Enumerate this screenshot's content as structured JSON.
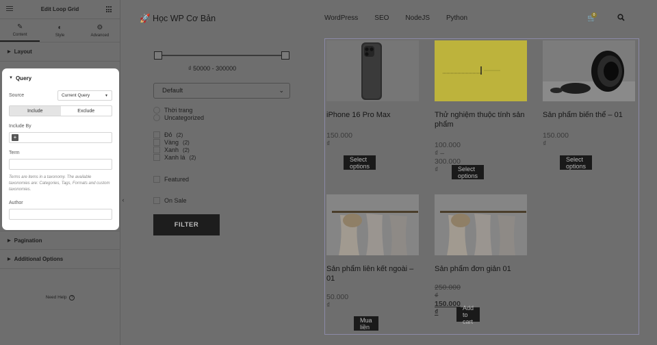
{
  "panel": {
    "title": "Edit Loop Grid",
    "tabs": [
      {
        "label": "Content",
        "icon": "pencil-icon",
        "glyph": "✎"
      },
      {
        "label": "Style",
        "icon": "contrast-icon",
        "glyph": "◐"
      },
      {
        "label": "Advanced",
        "icon": "gear-icon",
        "glyph": "⚙"
      }
    ],
    "sections": {
      "layout": "Layout",
      "query": "Query",
      "pagination": "Pagination",
      "additional": "Additional Options"
    },
    "query": {
      "source_label": "Source",
      "source_value": "Current Query",
      "include_label": "Include",
      "exclude_label": "Exclude",
      "include_by_label": "Include By",
      "term_label": "Term",
      "hint": "Terms are items in a taxonomy. The available taxonomies are: Categories, Tags, Formats and custom taxonomies.",
      "author_label": "Author"
    },
    "need_help": "Need Help"
  },
  "site": {
    "logo": "🚀 Học WP Cơ Bản",
    "nav": [
      "WordPress",
      "SEO",
      "NodeJS",
      "Python"
    ],
    "cart_count": "0"
  },
  "filters": {
    "price_range": "₫  50000   -   300000",
    "sort_value": "Default",
    "categories": [
      "Thời trang",
      "Uncategorized"
    ],
    "colors": [
      {
        "name": "Đỏ",
        "count": "(2)"
      },
      {
        "name": "Vàng",
        "count": "(2)"
      },
      {
        "name": "Xanh",
        "count": "(2)"
      },
      {
        "name": "Xanh lá",
        "count": "(2)"
      }
    ],
    "featured": "Featured",
    "on_sale": "On Sale",
    "filter_button": "FILTER"
  },
  "products": [
    {
      "name": "iPhone 16 Pro Max",
      "price": "150.000 ₫",
      "button": "Select options"
    },
    {
      "name": "Thử nghiệm thuộc tính sản phẩm",
      "price": "100.000 ₫ – 300.000 ₫",
      "button": "Select options"
    },
    {
      "name": "Sản phẩm biến thể – 01",
      "price": "150.000 ₫",
      "button": "Select options"
    },
    {
      "name": "Sản phẩm liên kết ngoài – 01",
      "price": "50.000 ₫",
      "button": "Mua liền"
    },
    {
      "name": "Sản phẩm đơn giản 01",
      "old_price": "250.000 ₫",
      "new_price": "150.000 ₫",
      "button": "Add to cart"
    }
  ],
  "colors": {
    "panel_bg": "#6e6e6e",
    "card_bg": "#ffffff",
    "button_bg": "#1a1a1a",
    "yellow": "#bdb33c",
    "grid_border": "#8c8aa8"
  }
}
